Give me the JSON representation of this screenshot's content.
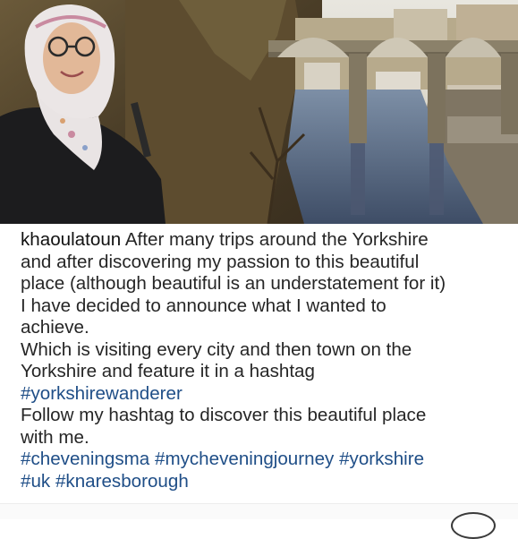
{
  "post": {
    "username": "khaoulatoun",
    "caption_lines": [
      " After many trips around the Yorkshire",
      "and after discovering my passion to this beautiful",
      "place (although beautiful is an understatement for it)",
      "I have decided to announce what I wanted to",
      "achieve.",
      "Which is visiting every city and then town on the",
      "Yorkshire and feature it in a hashtag"
    ],
    "hashtag_main": "#yorkshirewanderer",
    "follow_lines": [
      "Follow my hashtag to discover this beautiful place",
      "with me."
    ],
    "hashtags_line1": [
      "#cheveningsma",
      "#mycheveningjourney",
      "#yorkshire"
    ],
    "hashtags_line2": [
      "#uk",
      "#knaresborough"
    ]
  },
  "colors": {
    "hashtag": "#1f4e87",
    "text": "#262626"
  }
}
